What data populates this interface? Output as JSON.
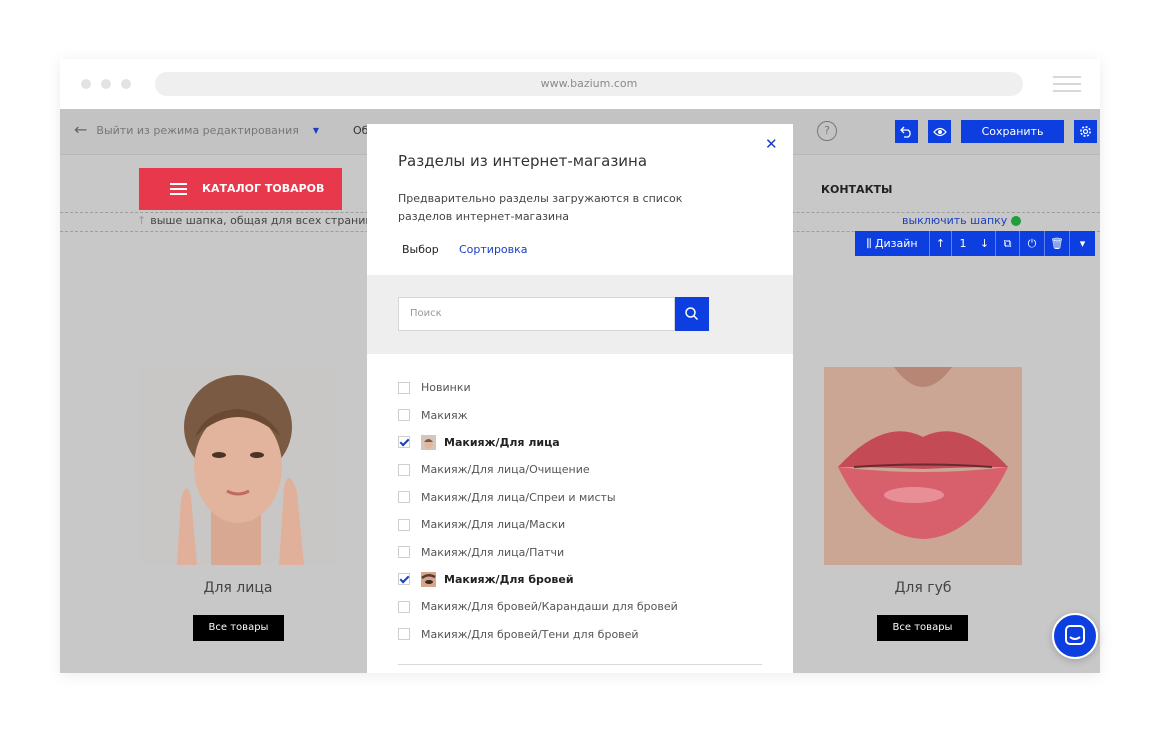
{
  "browser": {
    "url": "www.bazium.com"
  },
  "adminbar": {
    "exit_label": "Выйти из режима редактирования",
    "truncated_menu": "Об",
    "help": "?",
    "save_label": "Сохранить"
  },
  "header": {
    "catalog_label": "КАТАЛОГ ТОВАРОВ",
    "hint": "выше шапка, общая для всех страниц",
    "contacts": "КОНТАКТЫ",
    "hide_header": "выключить шапку"
  },
  "block_toolbar": {
    "design_label": "Дизайн",
    "index": "1"
  },
  "cards": [
    {
      "title": "Для лица",
      "button": "Все товары"
    },
    {
      "title": "Для губ",
      "button": "Все товары"
    }
  ],
  "modal": {
    "title": "Разделы из интернет-магазина",
    "description": "Предварительно разделы загружаются в список разделов интернет-магазина",
    "tabs": [
      "Выбор",
      "Сортировка"
    ],
    "search_placeholder": "Поиск",
    "items": [
      {
        "label": "Новинки",
        "checked": false
      },
      {
        "label": "Макияж",
        "checked": false
      },
      {
        "label": "Макияж/Для лица",
        "checked": true
      },
      {
        "label": "Макияж/Для лица/Очищение",
        "checked": false
      },
      {
        "label": "Макияж/Для лица/Спреи и мисты",
        "checked": false
      },
      {
        "label": "Макияж/Для лица/Маски",
        "checked": false
      },
      {
        "label": "Макияж/Для лица/Патчи",
        "checked": false
      },
      {
        "label": "Макияж/Для бровей",
        "checked": true
      },
      {
        "label": "Макияж/Для бровей/Карандаши для бровей",
        "checked": false
      },
      {
        "label": "Макияж/Для бровей/Тени для бровей",
        "checked": false
      }
    ]
  },
  "colors": {
    "accent": "#0d3fe0",
    "catalog_red": "#e8394c",
    "overlay_gray": "#c8c8c8"
  }
}
